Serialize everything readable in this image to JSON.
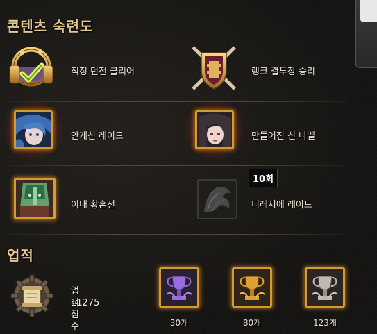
{
  "sections": {
    "mastery_title": "콘텐츠 숙련도",
    "achievement_title": "업적"
  },
  "mastery": {
    "items": [
      {
        "label": "적정 던전 클리어",
        "icon": "headset-check-icon"
      },
      {
        "label": "랭크 결투장 승리",
        "icon": "crossed-swords-shield-icon"
      },
      {
        "label": "안개신 레이드",
        "icon": "blue-haired-character-portrait-icon"
      },
      {
        "label": "만들어진 신 나벨",
        "icon": "dark-haired-character-portrait-icon"
      },
      {
        "label": "이내 황혼전",
        "icon": "green-armored-character-portrait-icon"
      },
      {
        "label": "디레지에 레이드",
        "icon": "shadow-creature-portrait-icon"
      }
    ],
    "tooltip": "10회"
  },
  "achievement": {
    "score_label": "업적 점수",
    "score_value": "11275점",
    "trophies": [
      {
        "count": "30개",
        "tier": "purple",
        "color": "#9b6be0"
      },
      {
        "count": "80개",
        "tier": "gold",
        "color": "#e0a030"
      },
      {
        "count": "123개",
        "tier": "silver",
        "color": "#c0b8b0"
      }
    ]
  },
  "colors": {
    "accent_gold": "#d79a2b",
    "heading": "#e6c88f"
  }
}
